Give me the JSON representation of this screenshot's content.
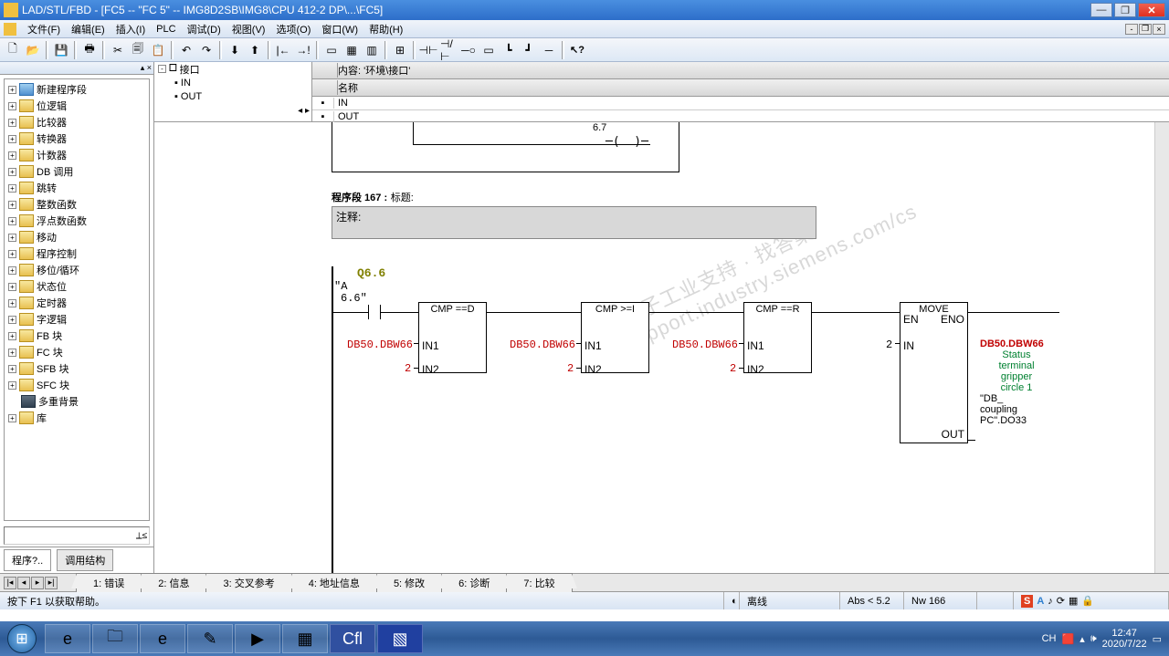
{
  "window": {
    "title": "LAD/STL/FBD  - [FC5 -- \"FC     5\" -- IMG8D2SB\\IMG8\\CPU 412-2 DP\\...\\FC5]"
  },
  "menu": {
    "file": "文件(F)",
    "edit": "编辑(E)",
    "insert": "插入(I)",
    "plc": "PLC",
    "debug": "调试(D)",
    "view": "视图(V)",
    "options": "选项(O)",
    "window": "窗口(W)",
    "help": "帮助(H)"
  },
  "left_tree": {
    "items": [
      {
        "label": "新建程序段",
        "special": true
      },
      {
        "label": "位逻辑"
      },
      {
        "label": "比较器"
      },
      {
        "label": "转换器"
      },
      {
        "label": "计数器"
      },
      {
        "label": "DB 调用"
      },
      {
        "label": "跳转"
      },
      {
        "label": "整数函数"
      },
      {
        "label": "浮点数函数"
      },
      {
        "label": "移动"
      },
      {
        "label": "程序控制"
      },
      {
        "label": "移位/循环"
      },
      {
        "label": "状态位"
      },
      {
        "label": "定时器"
      },
      {
        "label": "字逻辑"
      },
      {
        "label": "FB 块"
      },
      {
        "label": "FC 块"
      },
      {
        "label": "SFB 块"
      },
      {
        "label": "SFC 块"
      },
      {
        "label": "多重背景",
        "dark": true,
        "noexp": true
      },
      {
        "label": "库"
      }
    ],
    "tabs": {
      "program": "程序?..",
      "call": "调用结构"
    }
  },
  "interface": {
    "header": "内容:    '环境\\接口'",
    "root": "接口",
    "in": "IN",
    "out": "OUT",
    "col_name": "名称"
  },
  "ladder": {
    "partial_num": "6.7",
    "seg_label": "程序段  167 :",
    "seg_title": "标题:",
    "comment": "注释:",
    "addr_sym": "Q6.6",
    "addr_a": "\"A",
    "addr_66": "6.6\"",
    "cmp1": "CMP ==D",
    "cmp2": "CMP >=I",
    "cmp3": "CMP ==R",
    "move": "MOVE",
    "in1": "IN1",
    "in2": "IN2",
    "en": "EN",
    "eno": "ENO",
    "in": "IN",
    "out": "OUT",
    "db": "DB50.DBW66",
    "v2": "2",
    "out_addr": "DB50.DBW66",
    "out_c1": "Status",
    "out_c2": "terminal",
    "out_c3": "gripper",
    "out_c4": "circle 1",
    "out_s1": "\"DB_",
    "out_s2": "coupling",
    "out_s3": "PC\".DO33"
  },
  "bottom_tabs": {
    "t1": "1: 错误",
    "t2": "2: 信息",
    "t3": "3: 交叉参考",
    "t4": "4: 地址信息",
    "t5": "5: 修改",
    "t6": "6: 诊断",
    "t7": "7: 比较"
  },
  "status": {
    "help": "按下 F1 以获取帮助。",
    "offline": "离线",
    "abs": "Abs < 5.2",
    "nw": "Nw 166"
  },
  "tray": {
    "ch": "CH",
    "time": "12:47",
    "date": "2020/7/22"
  }
}
